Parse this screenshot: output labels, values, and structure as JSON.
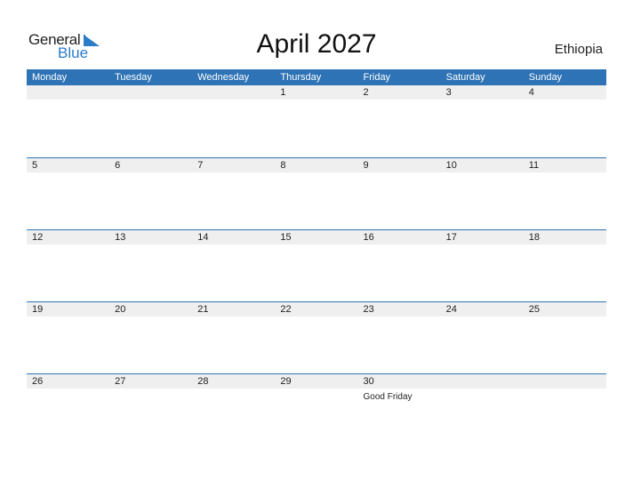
{
  "logo": {
    "line1": "General",
    "line2": "Blue"
  },
  "title": "April 2027",
  "country": "Ethiopia",
  "colors": {
    "accent": "#2e73b5",
    "date_strip": "#efefef"
  },
  "weekdays": [
    "Monday",
    "Tuesday",
    "Wednesday",
    "Thursday",
    "Friday",
    "Saturday",
    "Sunday"
  ],
  "weeks": [
    {
      "days": [
        "",
        "",
        "",
        "1",
        "2",
        "3",
        "4"
      ],
      "events": [
        "",
        "",
        "",
        "",
        "",
        "",
        ""
      ]
    },
    {
      "days": [
        "5",
        "6",
        "7",
        "8",
        "9",
        "10",
        "11"
      ],
      "events": [
        "",
        "",
        "",
        "",
        "",
        "",
        ""
      ]
    },
    {
      "days": [
        "12",
        "13",
        "14",
        "15",
        "16",
        "17",
        "18"
      ],
      "events": [
        "",
        "",
        "",
        "",
        "",
        "",
        ""
      ]
    },
    {
      "days": [
        "19",
        "20",
        "21",
        "22",
        "23",
        "24",
        "25"
      ],
      "events": [
        "",
        "",
        "",
        "",
        "",
        "",
        ""
      ]
    },
    {
      "days": [
        "26",
        "27",
        "28",
        "29",
        "30",
        "",
        ""
      ],
      "events": [
        "",
        "",
        "",
        "",
        "Good Friday",
        "",
        ""
      ]
    }
  ]
}
